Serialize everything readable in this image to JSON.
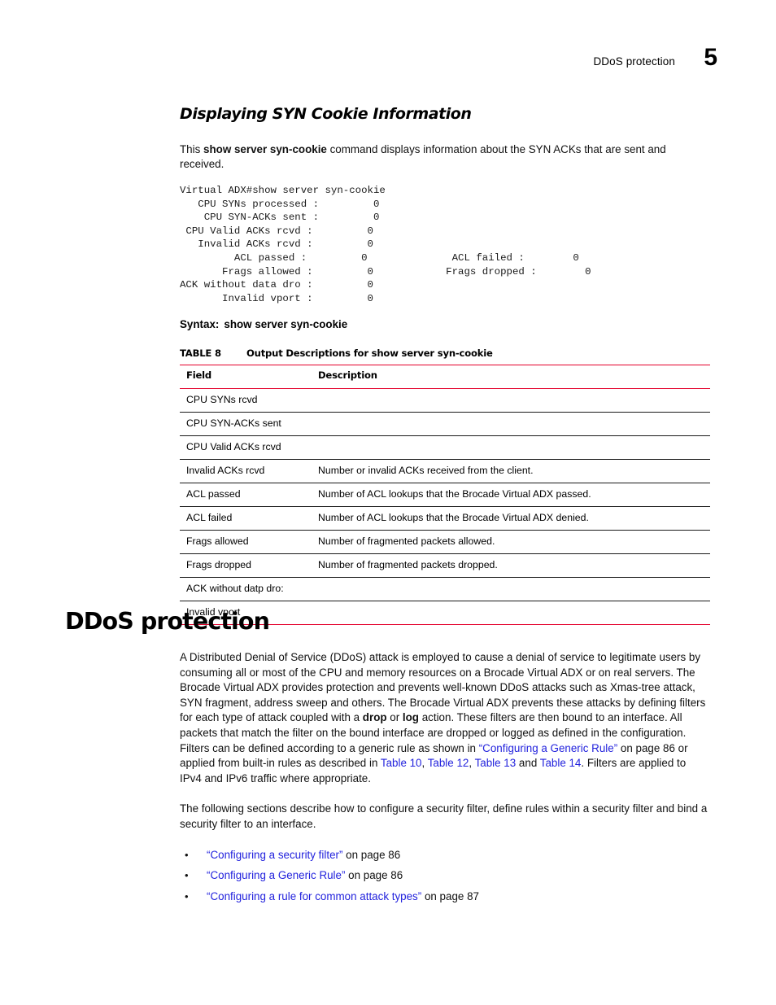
{
  "header": {
    "title": "DDoS protection",
    "chapter_number": "5"
  },
  "section": {
    "heading": "Displaying SYN Cookie Information",
    "intro_before": "This ",
    "intro_bold": "show server syn-cookie",
    "intro_after": " command displays information about the SYN ACKs that are sent and received."
  },
  "cli_output": "Virtual ADX#show server syn-cookie\n   CPU SYNs processed :         0\n    CPU SYN-ACKs sent :         0\n CPU Valid ACKs rcvd :         0\n   Invalid ACKs rcvd :         0\n         ACL passed :         0              ACL failed :        0\n       Frags allowed :         0            Frags dropped :        0\nACK without data dro :         0\n       Invalid vport :         0",
  "syntax": {
    "label": "Syntax:",
    "command": "show server syn-cookie"
  },
  "table": {
    "caption_number": "TABLE 8",
    "caption_title": "Output Descriptions for show server syn-cookie",
    "columns": [
      "Field",
      "Description"
    ],
    "rows": [
      {
        "field": "CPU SYNs rcvd",
        "description": ""
      },
      {
        "field": "CPU SYN-ACKs sent",
        "description": ""
      },
      {
        "field": "CPU Valid ACKs rcvd",
        "description": ""
      },
      {
        "field": "Invalid ACKs rcvd",
        "description": "Number or invalid ACKs received from the client."
      },
      {
        "field": "ACL passed",
        "description": "Number of ACL lookups that the Brocade Virtual ADX passed."
      },
      {
        "field": "ACL failed",
        "description": "Number of ACL lookups that the Brocade Virtual ADX denied."
      },
      {
        "field": "Frags allowed",
        "description": "Number of fragmented packets allowed."
      },
      {
        "field": "Frags dropped",
        "description": "Number of fragmented packets dropped."
      },
      {
        "field": "ACK without datp dro:",
        "description": ""
      },
      {
        "field": "Invalid vport",
        "description": ""
      }
    ]
  },
  "chapter": {
    "heading": "DDoS protection",
    "para1_a": "A Distributed Denial of Service (DDoS) attack is employed to cause a denial of service to legitimate users by consuming all or most of the CPU and memory resources on a Brocade Virtual ADX or on real servers. The Brocade Virtual ADX provides protection and prevents well-known DDoS attacks such as Xmas-tree attack, SYN fragment, address sweep and others. The Brocade Virtual ADX prevents these attacks by defining filters for each type of attack coupled with a ",
    "para1_bold1": "drop",
    "para1_b": " or ",
    "para1_bold2": "log",
    "para1_c": " action. These filters are then bound to an interface. All packets that match the filter on the bound interface are dropped or logged as defined in the configuration. Filters can be defined according to a generic rule as shown in ",
    "para1_link1": "“Configuring a Generic Rule”",
    "para1_d": " on page 86 or applied from built-in rules as described in ",
    "para1_link2": "Table 10",
    "para1_e": ", ",
    "para1_link3": "Table 12",
    "para1_f": ", ",
    "para1_link4": "Table 13",
    "para1_g": " and ",
    "para1_link5": "Table 14",
    "para1_h": ". Filters are applied to IPv4 and IPv6 traffic where appropriate.",
    "para2": "The following sections describe how to configure a security filter, define rules within a security filter and bind a security filter to an interface.",
    "bullets": [
      {
        "bullet": "•",
        "link": "“Configuring a security filter”",
        "tail": " on page 86"
      },
      {
        "bullet": "•",
        "link": "“Configuring a Generic Rule”",
        "tail": " on page 86"
      },
      {
        "bullet": "•",
        "link": "“Configuring a rule for common attack types”",
        "tail": " on page 87"
      }
    ]
  },
  "colors": {
    "rule_red": "#e4002b",
    "link_blue": "#2222dd",
    "text": "#111111"
  }
}
